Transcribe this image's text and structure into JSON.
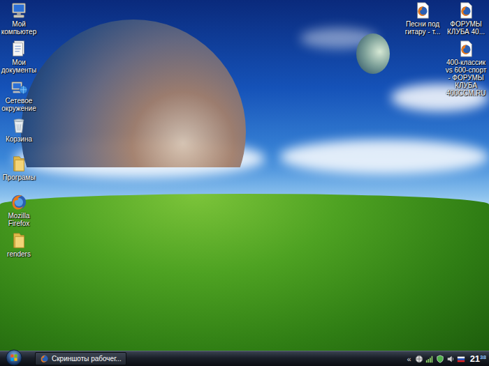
{
  "desktop": {
    "left_icons": [
      {
        "label": "Мой компьютер",
        "kind": "computer"
      },
      {
        "label": "Мои документы",
        "kind": "documents"
      },
      {
        "label": "Сетевое окружение",
        "kind": "network"
      },
      {
        "label": "Корзина",
        "kind": "bin"
      },
      {
        "label": "Програмы",
        "kind": "folder"
      },
      {
        "label": "Mozilla Firefox",
        "kind": "firefox"
      },
      {
        "label": "renders",
        "kind": "folder"
      }
    ],
    "right_icons": [
      {
        "label": "Песни под гитару - т...",
        "kind": "webpage"
      },
      {
        "label": "ФОРУМЫ КЛУБА 40...",
        "kind": "webpage"
      },
      {
        "label": "400-классик vs 600-спорт - ФОРУМЫ КЛУБА 400CCM.RU",
        "kind": "webpage"
      }
    ]
  },
  "taskbar": {
    "tasks": [
      {
        "label": "Скриншоты рабочег...",
        "selected": false
      }
    ],
    "tray": {
      "expand": "«",
      "clock": {
        "hours": "21",
        "minutes": "38"
      }
    }
  }
}
